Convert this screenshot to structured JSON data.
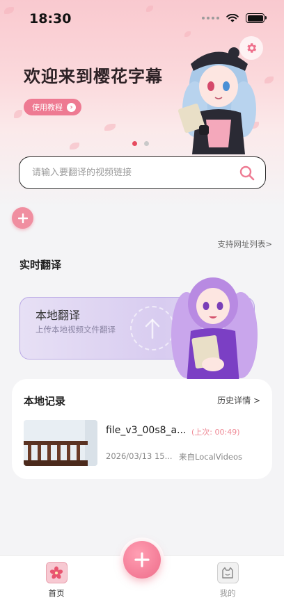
{
  "status_bar": {
    "time": "18:30"
  },
  "banner": {
    "title": "欢迎来到樱花字幕",
    "tutorial_label": "使用教程"
  },
  "search": {
    "placeholder": "请输入要翻译的视频链接"
  },
  "links": {
    "supported_sites": "支持网址列表>"
  },
  "realtime": {
    "title": "实时翻译"
  },
  "local_translate": {
    "title": "本地翻译",
    "subtitle": "上传本地视频文件翻译"
  },
  "records": {
    "title": "本地记录",
    "more_label": "历史详情 >",
    "items": [
      {
        "name": "file_v3_00s8_a...",
        "last": "(上次: 00:49)",
        "date": "2026/03/13 15...",
        "source": "来自LocalVideos"
      }
    ]
  },
  "tabbar": {
    "home_label": "首页",
    "mine_label": "我的"
  },
  "colors": {
    "accent": "#ee7a92",
    "active_dot": "#e64b5f",
    "card_border": "#b9a8e5"
  },
  "icons": [
    "gear-icon",
    "search-icon",
    "plus-icon",
    "arrow-right-icon",
    "upload-icon",
    "cherry-blossom-icon",
    "cat-face-icon",
    "wifi-icon",
    "battery-icon"
  ]
}
